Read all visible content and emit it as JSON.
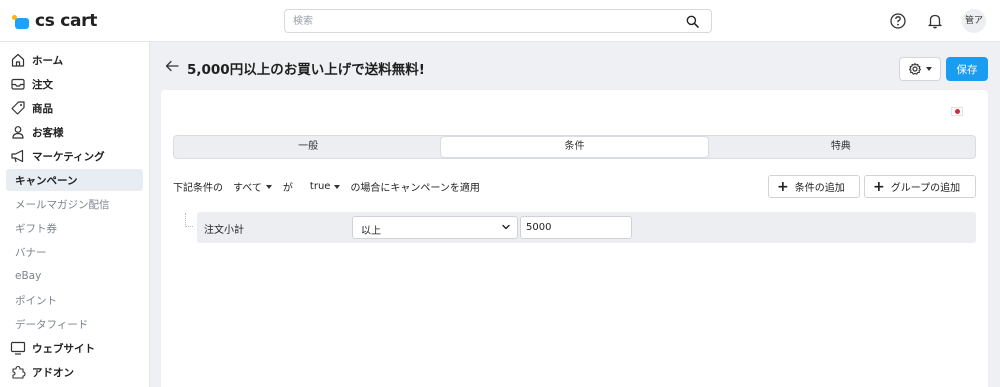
{
  "brand": {
    "name": "cs cart"
  },
  "search": {
    "placeholder": "検索"
  },
  "user": {
    "avatar_text": "管ア"
  },
  "sidebar": {
    "items": [
      {
        "label": "ホーム",
        "icon": "home-icon",
        "level": "top"
      },
      {
        "label": "注文",
        "icon": "inbox-icon",
        "level": "top"
      },
      {
        "label": "商品",
        "icon": "tag-icon",
        "level": "top"
      },
      {
        "label": "お客様",
        "icon": "user-icon",
        "level": "top"
      },
      {
        "label": "マーケティング",
        "icon": "megaphone-icon",
        "level": "top"
      },
      {
        "label": "キャンペーン",
        "level": "sub",
        "active": true
      },
      {
        "label": "メールマガジン配信",
        "level": "sub"
      },
      {
        "label": "ギフト券",
        "level": "sub"
      },
      {
        "label": "バナー",
        "level": "sub"
      },
      {
        "label": "eBay",
        "level": "sub"
      },
      {
        "label": "ポイント",
        "level": "sub"
      },
      {
        "label": "データフィード",
        "level": "sub"
      },
      {
        "label": "ウェブサイト",
        "icon": "monitor-icon",
        "level": "top"
      },
      {
        "label": "アドオン",
        "icon": "puzzle-icon",
        "level": "top"
      }
    ]
  },
  "page": {
    "title": "5,000円以上のお買い上げで送料無料!",
    "save_label": "保存"
  },
  "tabs": [
    {
      "label": "一般",
      "active": false
    },
    {
      "label": "条件",
      "active": true
    },
    {
      "label": "特典",
      "active": false
    }
  ],
  "conditions": {
    "prefix": "下記条件の",
    "match_value": "すべて",
    "particle": "が",
    "bool_value": "true",
    "suffix": "の場合にキャンペーンを適用",
    "add_condition_label": "条件の追加",
    "add_group_label": "グループの追加",
    "rows": [
      {
        "name": "注文小計",
        "operator": "以上",
        "value": "5000"
      }
    ]
  },
  "colors": {
    "accent": "#1a9cf0",
    "logo_blue": "#1aa3ff",
    "logo_yellow": "#ffb400",
    "background": "#eef0f4"
  }
}
